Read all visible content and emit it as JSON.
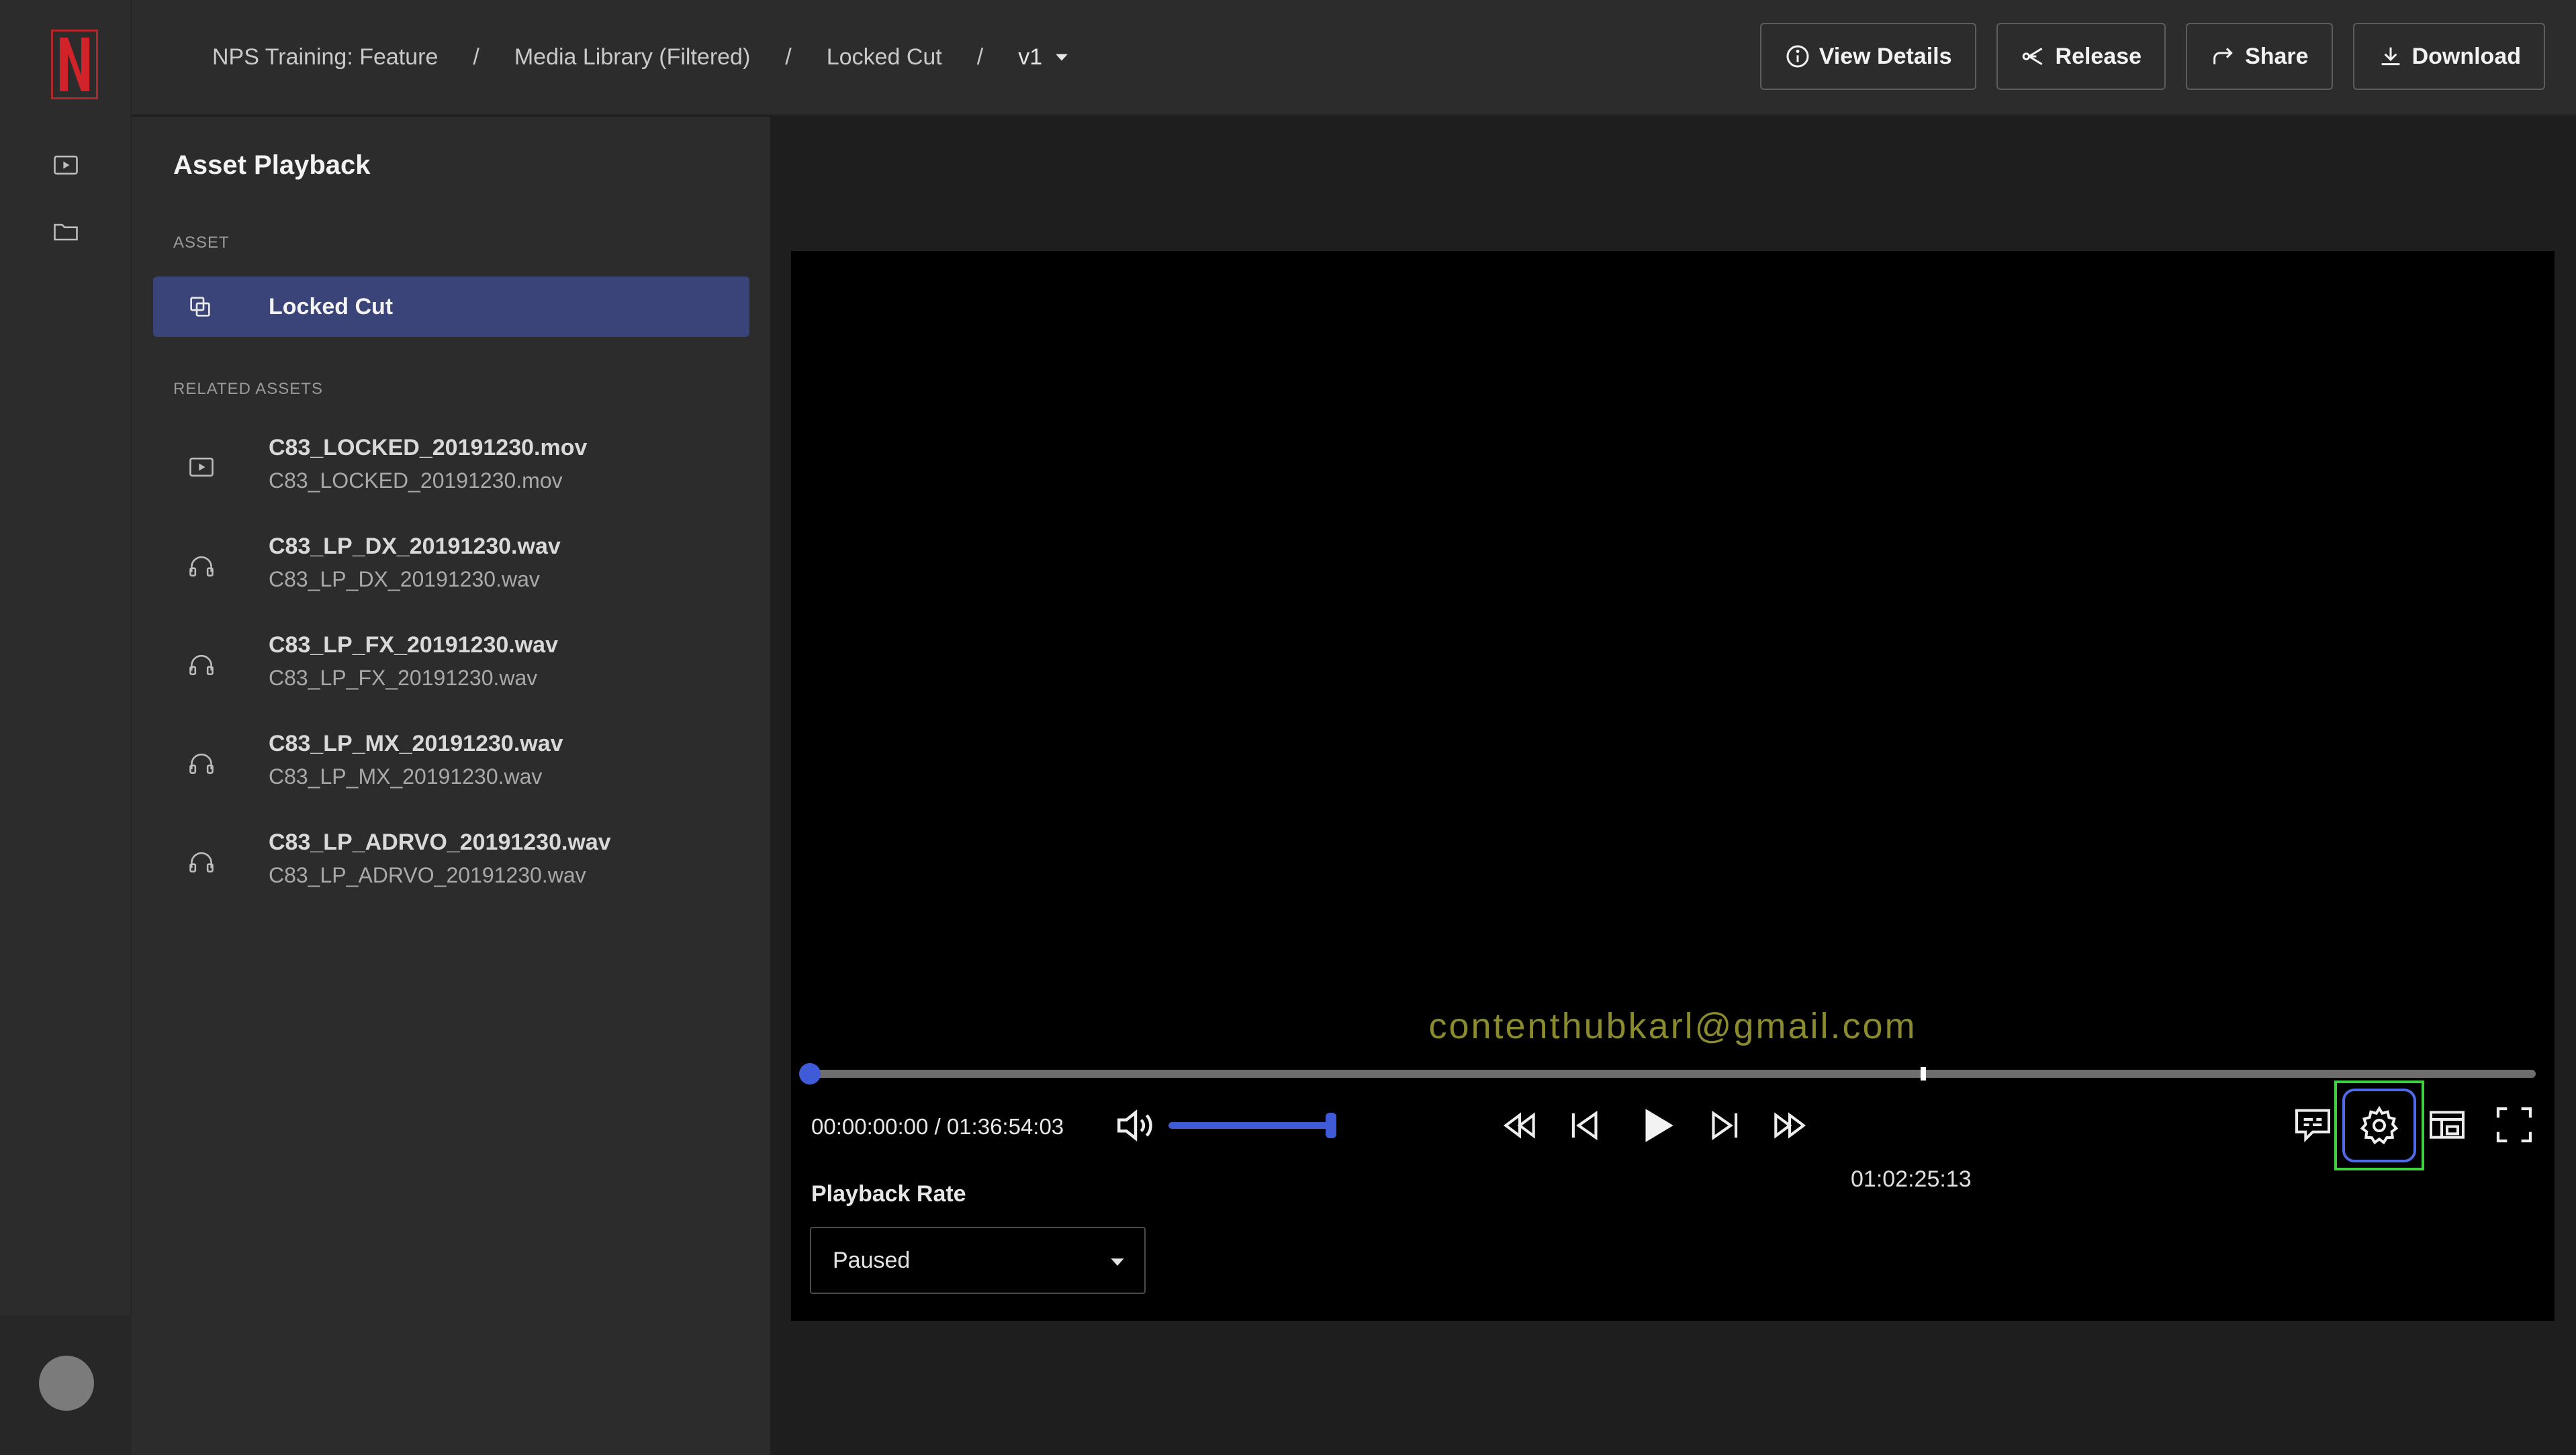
{
  "breadcrumb": {
    "items": [
      "NPS Training: Feature",
      "Media Library (Filtered)",
      "Locked Cut"
    ],
    "separator": "/",
    "version": "v1"
  },
  "toolbar": {
    "view_details": "View Details",
    "release": "Release",
    "share": "Share",
    "download": "Download"
  },
  "sidebar": {
    "title": "Asset Playback",
    "asset_label": "ASSET",
    "asset_name": "Locked Cut",
    "related_label": "RELATED ASSETS",
    "related": [
      {
        "name": "C83_LOCKED_20191230.mov",
        "sub": "C83_LOCKED_20191230.mov",
        "icon": "video-file-icon"
      },
      {
        "name": "C83_LP_DX_20191230.wav",
        "sub": "C83_LP_DX_20191230.wav",
        "icon": "headphones-icon"
      },
      {
        "name": "C83_LP_FX_20191230.wav",
        "sub": "C83_LP_FX_20191230.wav",
        "icon": "headphones-icon"
      },
      {
        "name": "C83_LP_MX_20191230.wav",
        "sub": "C83_LP_MX_20191230.wav",
        "icon": "headphones-icon"
      },
      {
        "name": "C83_LP_ADRVO_20191230.wav",
        "sub": "C83_LP_ADRVO_20191230.wav",
        "icon": "headphones-icon"
      }
    ]
  },
  "player": {
    "watermark": "contenthubkarl@gmail.com",
    "timecode": "00:00:00:00 / 01:36:54:03",
    "progress_fraction": 0.0,
    "marker_fraction": 0.645,
    "marker_time": "01:02:25:13",
    "volume_fraction": 1.0,
    "playback_rate_label": "Playback Rate",
    "playback_rate_value": "Paused"
  },
  "colors": {
    "accent": "#3f5bd8",
    "selected_row": "#3b4478",
    "highlight": "#3fd13f",
    "brand": "#b3262b"
  }
}
